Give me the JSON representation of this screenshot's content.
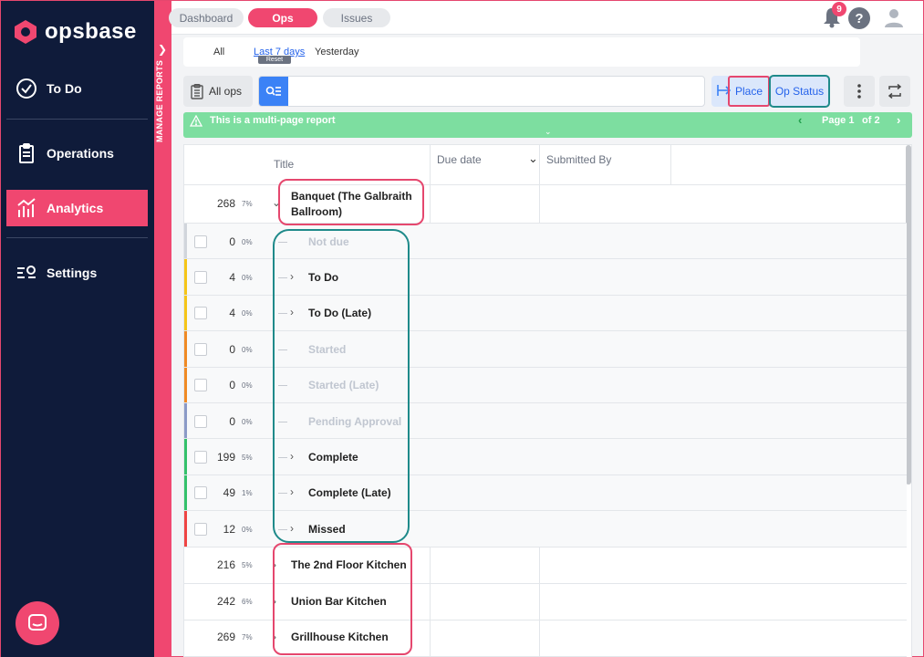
{
  "brand": {
    "name": "opsbase"
  },
  "sidebar": {
    "items": [
      {
        "label": "To Do",
        "icon": "check-circle-icon"
      },
      {
        "label": "Operations",
        "icon": "clipboard-icon"
      },
      {
        "label": "Analytics",
        "icon": "bar-chart-icon"
      },
      {
        "label": "Settings",
        "icon": "sliders-icon"
      }
    ],
    "active": "Analytics"
  },
  "manage_reports": {
    "label": "MANAGE REPORTS"
  },
  "topbar": {
    "tabs": [
      {
        "label": "Dashboard"
      },
      {
        "label": "Ops"
      },
      {
        "label": "Issues"
      }
    ],
    "active_tab": "Ops",
    "notifications_count": "9",
    "help_label": "?"
  },
  "date_filter": {
    "options": [
      "All",
      "Last 7 days",
      "Yesterday"
    ],
    "active": "Last 7 days",
    "reset_label": "Reset"
  },
  "toolbar": {
    "all_ops_label": "All ops",
    "search_value": "",
    "group_by": [
      "Place",
      "Op Status"
    ]
  },
  "banner": {
    "text": "This is a multi-page report",
    "page_label": "Page 1",
    "of_label": "of 2"
  },
  "table": {
    "columns": [
      "Title",
      "Due date",
      "Submitted By"
    ],
    "groups": [
      {
        "count": "268",
        "pct": "7%",
        "title": "Banquet (The Galbraith Ballroom)",
        "expanded": true
      },
      {
        "count": "216",
        "pct": "5%",
        "title": "The 2nd Floor Kitchen",
        "expanded": false
      },
      {
        "count": "242",
        "pct": "6%",
        "title": "Union Bar Kitchen",
        "expanded": false
      },
      {
        "count": "269",
        "pct": "7%",
        "title": "Grillhouse Kitchen",
        "expanded": false
      }
    ],
    "statuses": [
      {
        "count": "0",
        "pct": "0%",
        "title": "Not due",
        "color": "#d1d5db",
        "has_items": false
      },
      {
        "count": "4",
        "pct": "0%",
        "title": "To Do",
        "color": "#f5c518",
        "has_items": true
      },
      {
        "count": "4",
        "pct": "0%",
        "title": "To Do (Late)",
        "color": "#f5c518",
        "has_items": true
      },
      {
        "count": "0",
        "pct": "0%",
        "title": "Started",
        "color": "#f08a24",
        "has_items": false
      },
      {
        "count": "0",
        "pct": "0%",
        "title": "Started (Late)",
        "color": "#f08a24",
        "has_items": false
      },
      {
        "count": "0",
        "pct": "0%",
        "title": "Pending Approval",
        "color": "#8b9ac7",
        "has_items": false
      },
      {
        "count": "199",
        "pct": "5%",
        "title": "Complete",
        "color": "#34c16b",
        "has_items": true
      },
      {
        "count": "49",
        "pct": "1%",
        "title": "Complete (Late)",
        "color": "#34c16b",
        "has_items": true
      },
      {
        "count": "12",
        "pct": "0%",
        "title": "Missed",
        "color": "#ef4444",
        "has_items": true
      }
    ]
  }
}
